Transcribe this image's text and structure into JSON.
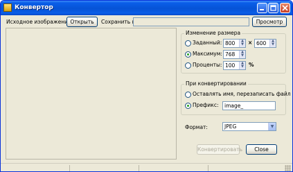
{
  "window": {
    "title": "Конвертор"
  },
  "source": {
    "label": "Исходное изображение:",
    "open_button": "Открыть",
    "save_to_label": "Сохранить в:",
    "save_to_value": "",
    "browse_button": "Просмотр"
  },
  "resize": {
    "title": "Изменение размера",
    "options": [
      {
        "label": "Заданный:",
        "selected": false
      },
      {
        "label": "Максимум:",
        "selected": true
      },
      {
        "label": "Проценты:",
        "selected": false
      }
    ],
    "custom_width": "800",
    "times_symbol": "×",
    "custom_height": "600",
    "max_value": "768",
    "percent_value": "100",
    "percent_symbol": "%"
  },
  "convert_options": {
    "title": "При конвертировании",
    "overwrite_label": "Оставлять имя, перезаписать файл",
    "overwrite_selected": false,
    "prefix_label": "Префикс:",
    "prefix_selected": true,
    "prefix_value": "image_"
  },
  "format": {
    "label": "Формат:",
    "selected": "JPEG"
  },
  "actions": {
    "convert_button": "Конвертировать",
    "close_button": "Close"
  },
  "colors": {
    "titlebar": "#0653d6",
    "window_bg": "#ece9d8",
    "radio_dot": "#21a121"
  },
  "icons": [
    "app-icon",
    "minimize-icon",
    "maximize-icon",
    "close-icon",
    "chevron-down-icon",
    "spin-up-icon",
    "spin-down-icon",
    "resize-grip-icon"
  ]
}
